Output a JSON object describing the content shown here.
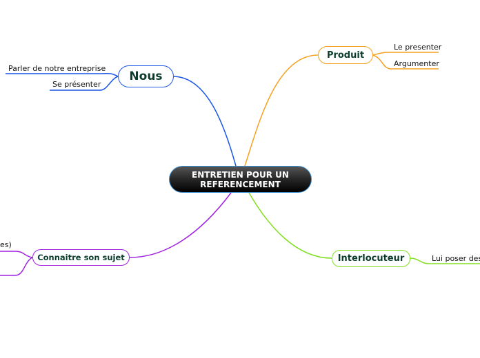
{
  "central": {
    "line1": "ENTRETIEN POUR UN",
    "line2": "REFERENCEMENT"
  },
  "branches": {
    "nous": {
      "label": "Nous",
      "color": "#1a55e6",
      "children": [
        "Parler de notre entreprise",
        "Se présenter"
      ]
    },
    "produit": {
      "label": "Produit",
      "color": "#f5a020",
      "children": [
        "Le presenter",
        "Argumenter"
      ]
    },
    "connaitre": {
      "label": "Connaitre son sujet",
      "color": "#a020e0",
      "children": [
        "es)",
        ""
      ]
    },
    "interlocuteur": {
      "label": "Interlocuteur",
      "color": "#80e020",
      "children": [
        "Lui poser des"
      ]
    }
  }
}
